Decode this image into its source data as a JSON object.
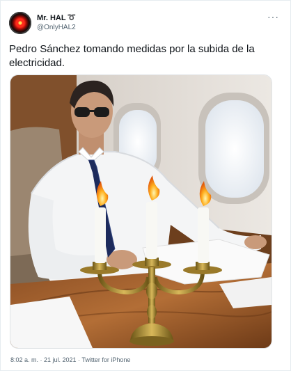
{
  "tweet": {
    "author": {
      "display_name": "Mr. HAL",
      "name_symbol": "➰",
      "handle": "@OnlyHAL2",
      "avatar_icon": "hal-9000-eye-icon"
    },
    "more_label": "···",
    "text": "Pedro Sánchez tomando medidas por la subida de la electricidad.",
    "image": {
      "description_icon": "man-on-private-jet-with-candelabra-image"
    },
    "timestamp": "8:02 a. m. · 21 jul. 2021 · Twitter for iPhone"
  },
  "colors": {
    "text": "#0f1419",
    "secondary_text": "#536471",
    "border": "#e6ecf0"
  }
}
